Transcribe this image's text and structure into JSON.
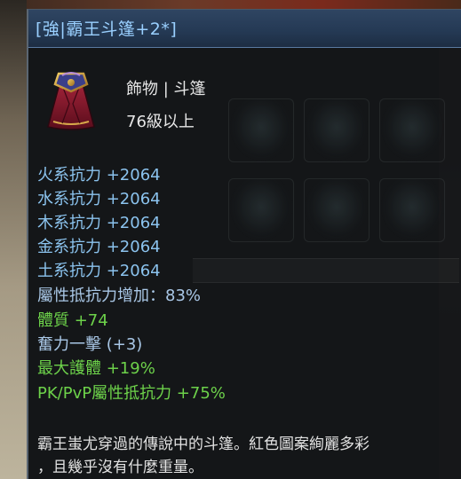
{
  "tooltip": {
    "title": "[強|霸王斗篷+2*]",
    "item_type": "飾物 | 斗篷",
    "item_level": "76級以上",
    "resistances": [
      "火系抗力 +2064",
      "水系抗力 +2064",
      "木系抗力 +2064",
      "金系抗力 +2064",
      "土系抗力 +2064"
    ],
    "attribute_resist_increase": "屬性抵抗力增加：83%",
    "bonus_stats": {
      "constitution": "體質 +74",
      "strike": "奮力一擊 (+3)",
      "max_protection": "最大護體 +19%",
      "pk_pvp": "PK/PvP屬性抵抗力 +75%"
    },
    "description": [
      "霸王蚩尤穿過的傳說中的斗篷。紅色圖案絢麗多彩",
      "，且幾乎沒有什麼重量。"
    ],
    "icon": "cape-icon",
    "colors": {
      "title": "#9ad0ff",
      "resist": "#8bc3ee",
      "bonus": "#6dd24a",
      "neutral": "#e6e6e6"
    }
  }
}
